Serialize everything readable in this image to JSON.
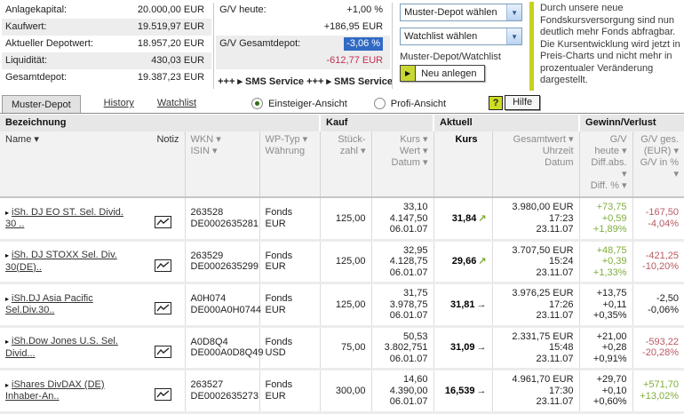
{
  "summary": {
    "rows": [
      {
        "label": "Anlagekapital:",
        "value": "20.000,00 EUR"
      },
      {
        "label": "Kaufwert:",
        "value": "19.519,97 EUR"
      },
      {
        "label": "Aktueller Depotwert:",
        "value": "18.957,20 EUR"
      },
      {
        "label": "Liquidität:",
        "value": "430,03 EUR"
      },
      {
        "label": "Gesamtdepot:",
        "value": "19.387,23 EUR"
      }
    ]
  },
  "performance": {
    "today_label": "G/V heute:",
    "today_pct": "+1,00 %",
    "today_abs": "+186,95 EUR",
    "total_label": "G/V Gesamtdepot:",
    "total_pct": "-3,06 %",
    "total_abs": "-612,77 EUR",
    "ticker": "+++ ▸ SMS Service +++ ▸ SMS Service"
  },
  "controls": {
    "depot_dropdown": "Muster-Depot wählen",
    "watchlist_dropdown": "Watchlist wählen",
    "new_caption": "Muster-Depot/Watchlist",
    "new_button": "Neu anlegen"
  },
  "notice": {
    "text": "Durch unsere neue Fondskursversorgung sind nun deutlich mehr Fonds abfragbar. Die Kursentwicklung wird jetzt in Preis-Charts und nicht mehr in prozentualer Veränderung dargestellt."
  },
  "tabs": {
    "active": "Muster-Depot",
    "links": [
      "History",
      "Watchlist"
    ]
  },
  "views": {
    "beginner": "Einsteiger-Ansicht",
    "pro": "Profi-Ansicht",
    "help_icon": "?",
    "help": "Hilfe"
  },
  "table": {
    "groups": [
      "Bezeichnung",
      "Kauf",
      "Aktuell",
      "Gewinn/Verlust"
    ],
    "headers": {
      "name": "Name ▾",
      "notiz": "Notiz",
      "wkn": "WKN ▾\nISIN ▾",
      "typ": "WP-Typ ▾\nWährung",
      "stueck": "Stück-\nzahl ▾",
      "kauf": "Kurs ▾\nWert ▾\nDatum ▾",
      "kurs": "Kurs",
      "aktuell": "Gesamtwert ▾\nUhrzeit\nDatum",
      "gv_heute": "G/V heute ▾\nDiff.abs. ▾\nDiff. % ▾",
      "gv_ges": "G/V ges.\n(EUR) ▾\nG/V in % ▾"
    },
    "rows": [
      {
        "name": "iSh. DJ EO ST. Sel. Divid. 30 ..",
        "wkn": "263528\nDE0002635281",
        "typ": "Fonds\nEUR",
        "stueck": "125,00",
        "kauf": "33,10\n4.147,50\n06.01.07",
        "kurs": "31,84",
        "trend": "↗",
        "trend_color": "green",
        "aktuell": "3.980,00 EUR\n17:23\n23.11.07",
        "gv_heute": "+73,75\n+0,59\n+1,89%",
        "gv_heute_color": "green",
        "gv_ges": "-167,50\n-4,04%",
        "gv_ges_color": "red"
      },
      {
        "name": "iSh. DJ STOXX Sel. Div. 30(DE)..",
        "wkn": "263529\nDE0002635299",
        "typ": "Fonds\nEUR",
        "stueck": "125,00",
        "kauf": "32,95\n4.128,75\n06.01.07",
        "kurs": "29,66",
        "trend": "↗",
        "trend_color": "green",
        "aktuell": "3.707,50 EUR\n15:24\n23.11.07",
        "gv_heute": "+48,75\n+0,39\n+1,33%",
        "gv_heute_color": "green",
        "gv_ges": "-421,25\n-10,20%",
        "gv_ges_color": "red"
      },
      {
        "name": "iSh.DJ Asia Pacific Sel.Div.30..",
        "wkn": "A0H074\nDE000A0H0744",
        "typ": "Fonds\nEUR",
        "stueck": "125,00",
        "kauf": "31,75\n3.978,75\n06.01.07",
        "kurs": "31,81",
        "trend": "→",
        "trend_color": "black",
        "aktuell": "3.976,25 EUR\n17:26\n23.11.07",
        "gv_heute": "+13,75\n+0,11\n+0,35%",
        "gv_heute_color": "black",
        "gv_ges": "-2,50\n-0,06%",
        "gv_ges_color": "black"
      },
      {
        "name": "iSh.Dow Jones U.S. Sel. Divid...",
        "wkn": "A0D8Q4\nDE000A0D8Q49",
        "typ": "Fonds\nUSD",
        "stueck": "75,00",
        "kauf": "50,53\n3.802,751\n06.01.07",
        "kurs": "31,09",
        "trend": "→",
        "trend_color": "black",
        "aktuell": "2.331,75 EUR\n15:48\n23.11.07",
        "gv_heute": "+21,00\n+0,28\n+0,91%",
        "gv_heute_color": "black",
        "gv_ges": "-593,22\n-20,28%",
        "gv_ges_color": "red"
      },
      {
        "name": "iShares DivDAX (DE) Inhaber-An..",
        "wkn": "263527\nDE0002635273",
        "typ": "Fonds\nEUR",
        "stueck": "300,00",
        "kauf": "14,60\n4.390,00\n06.01.07",
        "kurs": "16,539",
        "trend": "→",
        "trend_color": "black",
        "aktuell": "4.961,70 EUR\n17:30\n23.11.07",
        "gv_heute": "+29,70\n+0,10\n+0,60%",
        "gv_heute_color": "black",
        "gv_ges": "+571,70\n+13,02%",
        "gv_ges_color": "green"
      }
    ]
  },
  "theme": {
    "positive": "#7fae3a",
    "negative": "#b85a64",
    "selection_blue": "#316ac5",
    "accent_green": "#c6d21f"
  }
}
